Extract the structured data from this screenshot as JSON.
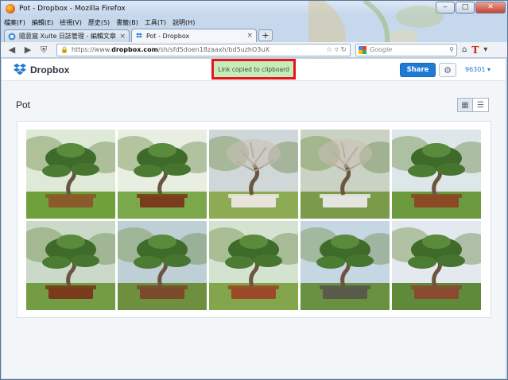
{
  "window": {
    "title": "Pot - Dropbox - Mozilla Firefox",
    "controls": {
      "minimize": "‒",
      "maximize": "□",
      "close": "✕"
    }
  },
  "menubar": [
    "檔案(F)",
    "編輯(E)",
    "檢視(V)",
    "歷史(S)",
    "書籤(B)",
    "工具(T)",
    "說明(H)"
  ],
  "tabs": [
    {
      "label": "隨意窩 Xuite 日誌管理 - 編輯文章",
      "active": false
    },
    {
      "label": "Pot - Dropbox",
      "active": true
    }
  ],
  "navbar": {
    "url_prefix": "https://www.",
    "url_domain": "dropbox.com",
    "url_path": "/sh/sfd5doen18zaaxh/bd5uzhO3uX",
    "search_placeholder": "Google"
  },
  "dropbox": {
    "logo_text": "Dropbox",
    "toast": "Link copied to clipboard",
    "share_label": "Share",
    "user_label": "96301",
    "folder_title": "Pot"
  },
  "photos": [
    {
      "name": "bonsai-1",
      "theme": "green"
    },
    {
      "name": "bonsai-2",
      "theme": "green"
    },
    {
      "name": "bonsai-3",
      "theme": "bare"
    },
    {
      "name": "bonsai-4",
      "theme": "bare"
    },
    {
      "name": "bonsai-5",
      "theme": "green"
    },
    {
      "name": "bonsai-6",
      "theme": "green"
    },
    {
      "name": "bonsai-7",
      "theme": "green"
    },
    {
      "name": "bonsai-8",
      "theme": "green"
    },
    {
      "name": "bonsai-9",
      "theme": "green"
    },
    {
      "name": "bonsai-10",
      "theme": "green"
    }
  ],
  "colors": {
    "accent": "#1f7ad6",
    "toast_border": "#e8141b",
    "toast_bg": "#c7ecbb"
  }
}
